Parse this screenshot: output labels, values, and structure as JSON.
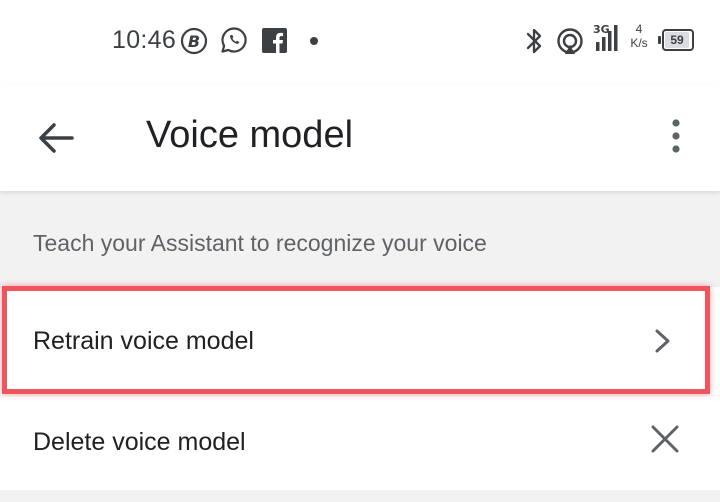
{
  "status_bar": {
    "time": "10:46",
    "notification_icons": [
      "b-icon",
      "whatsapp-icon",
      "facebook-icon",
      "dot-icon"
    ],
    "network_label_top": "3G",
    "speed_value": "4",
    "speed_unit": "K/s",
    "battery_level": "59"
  },
  "app_bar": {
    "title": "Voice model",
    "back_icon": "arrow-back-icon",
    "menu_icon": "more-vert-icon"
  },
  "content": {
    "section_text": "Teach your Assistant to recognize your voice",
    "items": [
      {
        "label": "Retrain voice model",
        "trailing_icon": "chevron-right-icon",
        "highlighted": true
      },
      {
        "label": "Delete voice model",
        "trailing_icon": "close-icon",
        "highlighted": false
      }
    ]
  },
  "colors": {
    "highlight": "#f0545c",
    "background": "#f2f2f2",
    "surface": "#ffffff",
    "text_primary": "#202124",
    "text_secondary": "#5f6368"
  }
}
